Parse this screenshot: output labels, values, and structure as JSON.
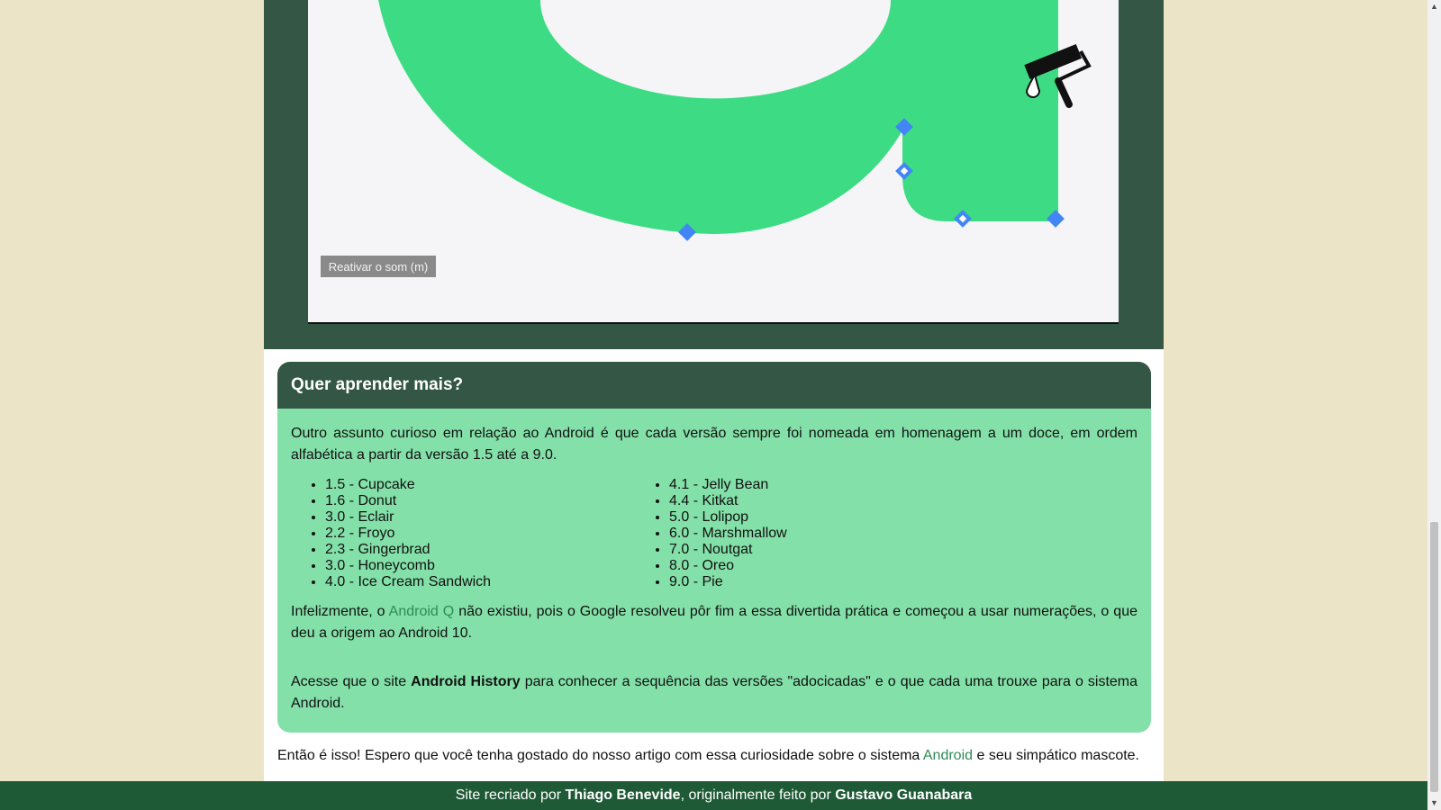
{
  "video": {
    "mute_button_label": "Reativar o som (m)"
  },
  "card": {
    "heading": "Quer aprender mais?",
    "intro": "Outro assunto curioso em relação ao Android é que cada versão sempre foi nomeada em homenagem a um doce, em ordem alfabética a partir da versão 1.5 até a 9.0.",
    "versions_left": [
      "1.5 - Cupcake",
      "1.6 - Donut",
      "3.0 - Eclair",
      "2.2 - Froyo",
      "2.3 - Gingerbrad",
      "3.0 - Honeycomb",
      "4.0 - Ice Cream Sandwich"
    ],
    "versions_right": [
      "4.1 - Jelly Bean",
      "4.4 - Kitkat",
      "5.0 - Lolipop",
      "6.0 - Marshmallow",
      "7.0 - Noutgat",
      "8.0 - Oreo",
      "9.0 - Pie"
    ],
    "para2_before": "Infelizmente, o ",
    "para2_link": "Android Q",
    "para2_after": " não existiu, pois o Google resolveu pôr fim a essa divertida prática e começou a usar numerações, o que deu a origem ao Android 10.",
    "para3_before": "Acesse que o site ",
    "para3_bold": "Android History",
    "para3_after": " para conhecer a sequência das versões \"adocicadas\" e o que cada uma trouxe para o sistema Android."
  },
  "closing": {
    "before": "Então é isso! Espero que você tenha gostado do nosso artigo com essa curiosidade sobre o sistema ",
    "link": "Android",
    "after": " e seu simpático mascote."
  },
  "footer": {
    "prefix": "Site recriado por ",
    "author": "Thiago Benevide",
    "middle": ", originalmente feito por ",
    "original_author": "Gustavo Guanabara"
  },
  "scrollbar": {
    "up_icon": "▲",
    "down_icon": "▼"
  },
  "colors": {
    "page_background": "#ece4c6",
    "dark_green": "#335744",
    "card_green": "#84e0a9",
    "shape_green": "#3ddc84",
    "handle_blue": "#4285f4",
    "footer_green": "#1e5a35",
    "link_green": "#2e8b57"
  },
  "icons": {
    "paint_roller": "paint-roller-icon",
    "bezier_handle": "bezier-handle-icon"
  }
}
